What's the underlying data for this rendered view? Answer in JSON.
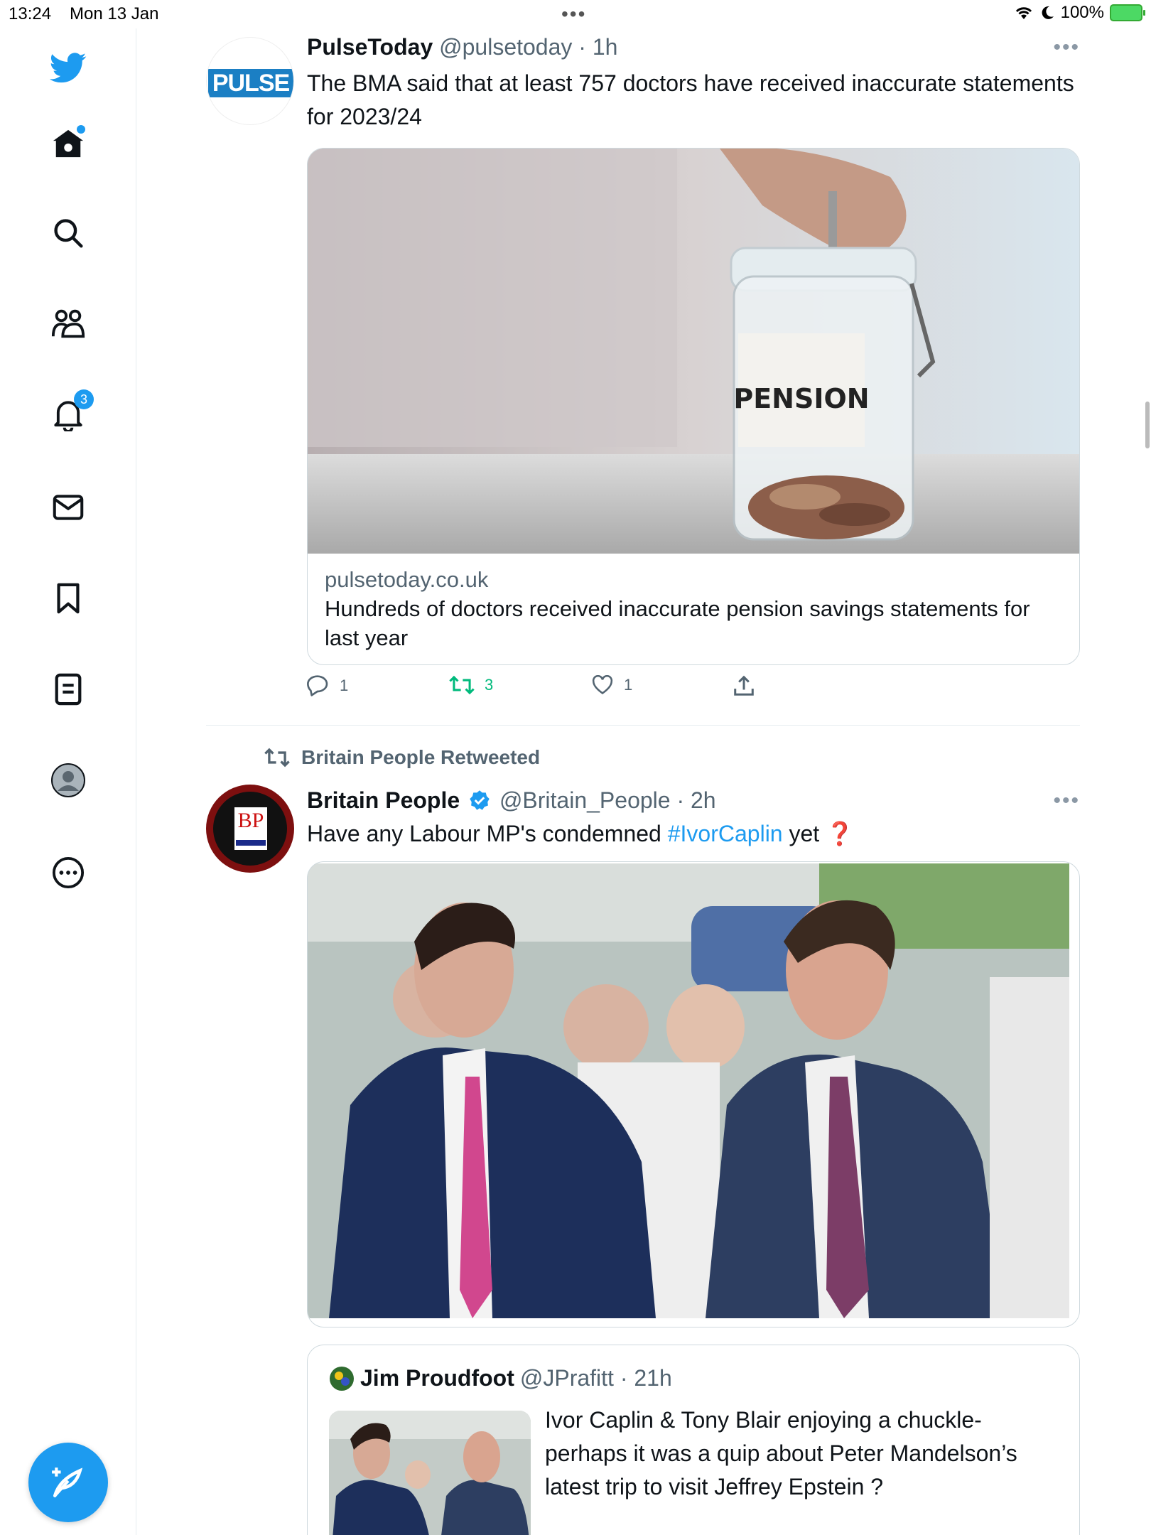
{
  "status_bar": {
    "time": "13:24",
    "date": "Mon 13 Jan",
    "battery": "100%"
  },
  "sidebar": {
    "items": [
      {
        "name": "twitter-logo"
      },
      {
        "name": "home"
      },
      {
        "name": "explore"
      },
      {
        "name": "communities"
      },
      {
        "name": "notifications",
        "badge": "3"
      },
      {
        "name": "messages"
      },
      {
        "name": "bookmarks"
      },
      {
        "name": "lists"
      },
      {
        "name": "profile"
      },
      {
        "name": "more"
      }
    ]
  },
  "tweets": [
    {
      "name": "PulseToday",
      "handle": "@pulsetoday",
      "sep": " · ",
      "time": "1h",
      "avatar_text": "PULSE",
      "text": "The BMA said that at least 757 doctors have received inaccurate statements for 2023/24",
      "card": {
        "image_label": "PENSION",
        "domain": "pulsetoday.co.uk",
        "title": "Hundreds of doctors received inaccurate pension savings statements for last year"
      },
      "actions": {
        "replies": "1",
        "retweets": "3",
        "likes": "1"
      }
    },
    {
      "retweeted_by": "Britain People Retweeted",
      "name": "Britain People",
      "handle": "@Britain_People",
      "sep": " · ",
      "time": "2h",
      "avatar_text": "BP",
      "text_before": "Have any Labour MP's condemned ",
      "hashtag": "#IvorCaplin",
      "text_after": " yet ❓",
      "quote": {
        "name": "Jim Proudfoot",
        "handle": "@JPrafitt",
        "sep": " · ",
        "time": "21h",
        "text": "Ivor Caplin & Tony Blair enjoying a chuckle- perhaps it was a quip about Peter Mandelson’s latest trip to visit Jeffrey Epstein ?"
      }
    }
  ],
  "colors": {
    "accent": "#1d9bf0",
    "retweet": "#00ba7c",
    "muted": "#536471"
  }
}
